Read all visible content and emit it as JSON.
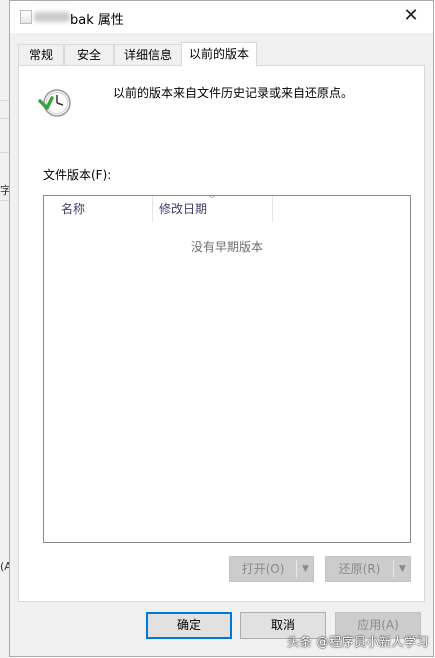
{
  "window": {
    "title": "bak 属性",
    "close_glyph": "✕"
  },
  "tabs": [
    {
      "label": "常规"
    },
    {
      "label": "安全"
    },
    {
      "label": "详细信息"
    },
    {
      "label": "以前的版本",
      "active": true
    }
  ],
  "previous_versions": {
    "description": "以前的版本来自文件历史记录或来自还原点。",
    "file_versions_label": "文件版本(F):",
    "columns": [
      "名称",
      "修改日期"
    ],
    "empty_message": "没有早期版本",
    "open_button": "打开(O)",
    "restore_button": "还原(R)",
    "dropdown_glyph": "▼"
  },
  "footer": {
    "ok": "确定",
    "cancel": "取消",
    "apply": "应用(A)"
  },
  "background_fragments": [
    "字",
    "(A"
  ],
  "watermark": "头条 @程序员小新人学习",
  "colors": {
    "accent": "#0078d7",
    "disabled": "#cccccc",
    "icon_green": "#3aa53a"
  },
  "icons": [
    "file-icon",
    "close-icon",
    "history-clock-icon",
    "chevron-down-icon"
  ]
}
